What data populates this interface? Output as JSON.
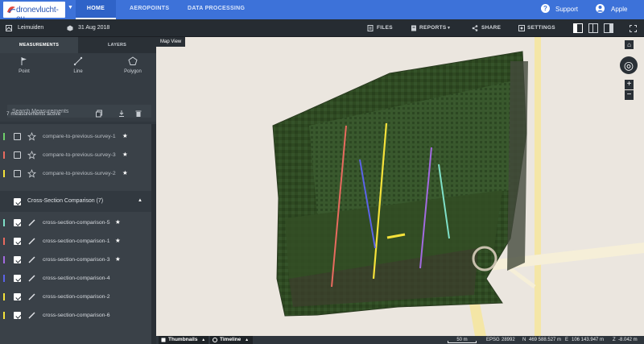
{
  "brand": {
    "name": "dronevlucht-eu",
    "accent": "#3d72d9"
  },
  "nav": {
    "tabs": [
      "HOME",
      "AEROPOINTS",
      "DATA PROCESSING"
    ],
    "active": "HOME",
    "support": "Support",
    "user": "Apple"
  },
  "project": {
    "site": "Leimuiden",
    "date": "31 Aug 2018"
  },
  "toolbar": {
    "files": "FILES",
    "reports": "REPORTS",
    "share": "SHARE",
    "settings": "SETTINGS"
  },
  "panel": {
    "tabs": [
      "MEASUREMENTS",
      "LAYERS"
    ],
    "tools": [
      "Point",
      "Line",
      "Polygon"
    ],
    "search_placeholder": "Search Measurements",
    "active_count": "7 measurements active"
  },
  "measurements": [
    {
      "name": "compare-to-previous-survey-1",
      "color": "#6fcf6a",
      "checked": false,
      "starred": true
    },
    {
      "name": "compare-to-previous-survey-3",
      "color": "#e86b5f",
      "checked": false,
      "starred": true
    },
    {
      "name": "compare-to-previous-survey-2",
      "color": "#f5e23a",
      "checked": false,
      "starred": true
    }
  ],
  "group": {
    "label": "Cross-Section Comparison (7)",
    "items": [
      {
        "name": "cross-section-comparison-5",
        "color": "#7fe0c8",
        "checked": true,
        "starred": true
      },
      {
        "name": "cross-section-comparison-1",
        "color": "#e86b5f",
        "checked": true,
        "starred": true
      },
      {
        "name": "cross-section-comparison-3",
        "color": "#a26be0",
        "checked": true,
        "starred": true
      },
      {
        "name": "cross-section-comparison-4",
        "color": "#5b63e8",
        "checked": true,
        "starred": false
      },
      {
        "name": "cross-section-comparison-2",
        "color": "#f5e23a",
        "checked": true,
        "starred": false
      },
      {
        "name": "cross-section-comparison-6",
        "color": "#f5e23a",
        "checked": true,
        "starred": false
      }
    ]
  },
  "map": {
    "label": "Map View",
    "scale": "50 m",
    "epsg_label": "EPSG",
    "epsg": "28992",
    "n_label": "N",
    "n_value": "469 588.527 m",
    "e_label": "E",
    "e_value": "106 143.947 m",
    "z_label": "Z",
    "z_value": "-8.042 m"
  },
  "bottom": {
    "thumbnails": "Thumbnails",
    "timeline": "Timeline"
  }
}
